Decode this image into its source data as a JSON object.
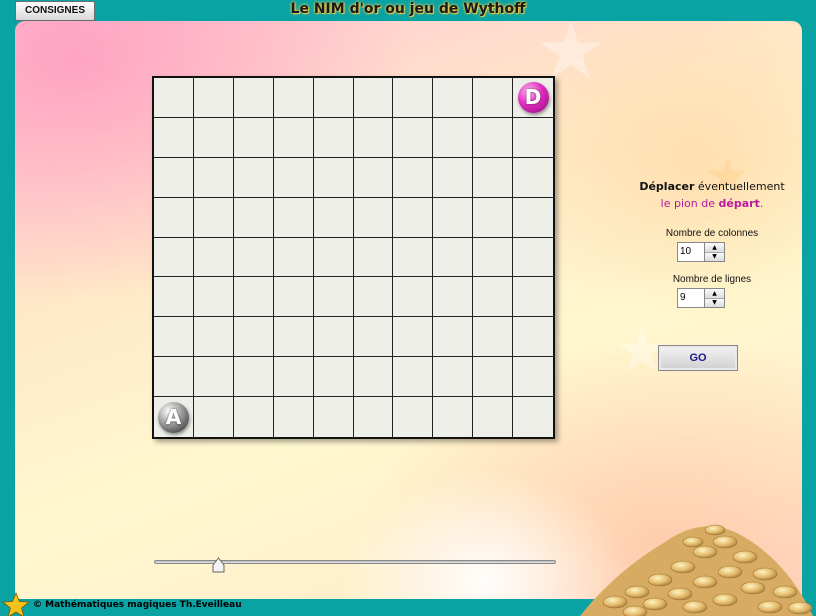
{
  "app": {
    "title": "Le NIM d'or ou jeu de Wythoff",
    "consignes_label": "CONSIGNES"
  },
  "board": {
    "columns": 10,
    "rows": 9,
    "pieces": [
      {
        "label": "D",
        "row": 1,
        "col": 10,
        "color": "magenta"
      },
      {
        "label": "A",
        "row": 9,
        "col": 1,
        "color": "silver"
      }
    ]
  },
  "sidebar": {
    "instruction_line1_bold": "Déplacer",
    "instruction_line1_rest": " éventuellement",
    "instruction_line2_start": "le pion de ",
    "instruction_line2_bold": "départ",
    "instruction_line2_end": ".",
    "columns_label": "Nombre de colonnes",
    "columns_value": "10",
    "rows_label": "Nombre de lignes",
    "rows_value": "9",
    "go_label": "GO"
  },
  "slider": {
    "value_fraction": 0.16
  },
  "footer": {
    "copyright": "© Mathématiques magiques Th.Eveilleau"
  },
  "colors": {
    "frame": "#0aa3a3",
    "accent_pink": "#b8199e",
    "go_text": "#1a1a8c"
  }
}
